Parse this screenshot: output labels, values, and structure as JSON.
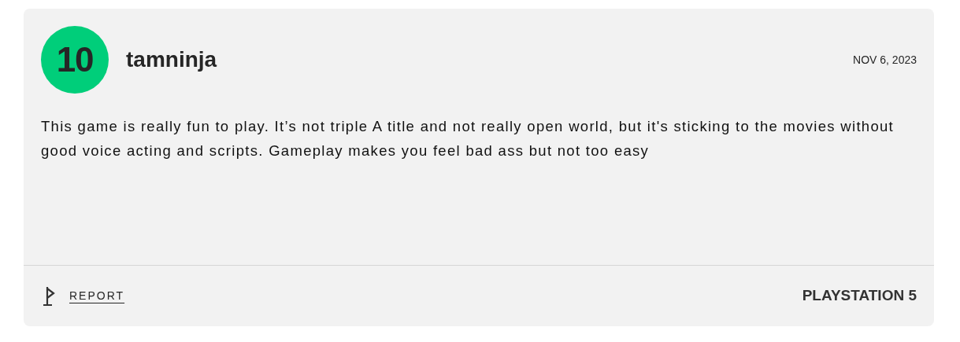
{
  "review": {
    "score": {
      "value": "10",
      "color": "#00ce7a"
    },
    "author": "tamninja",
    "date": "NOV 6, 2023",
    "text": "This game is really fun to play. It’s not triple A title and not really open world, but it's sticking to the movies without good voice acting and scripts. Gameplay makes you feel bad ass but not too easy",
    "report": "REPORT",
    "platform": "PLAYSTATION 5"
  }
}
